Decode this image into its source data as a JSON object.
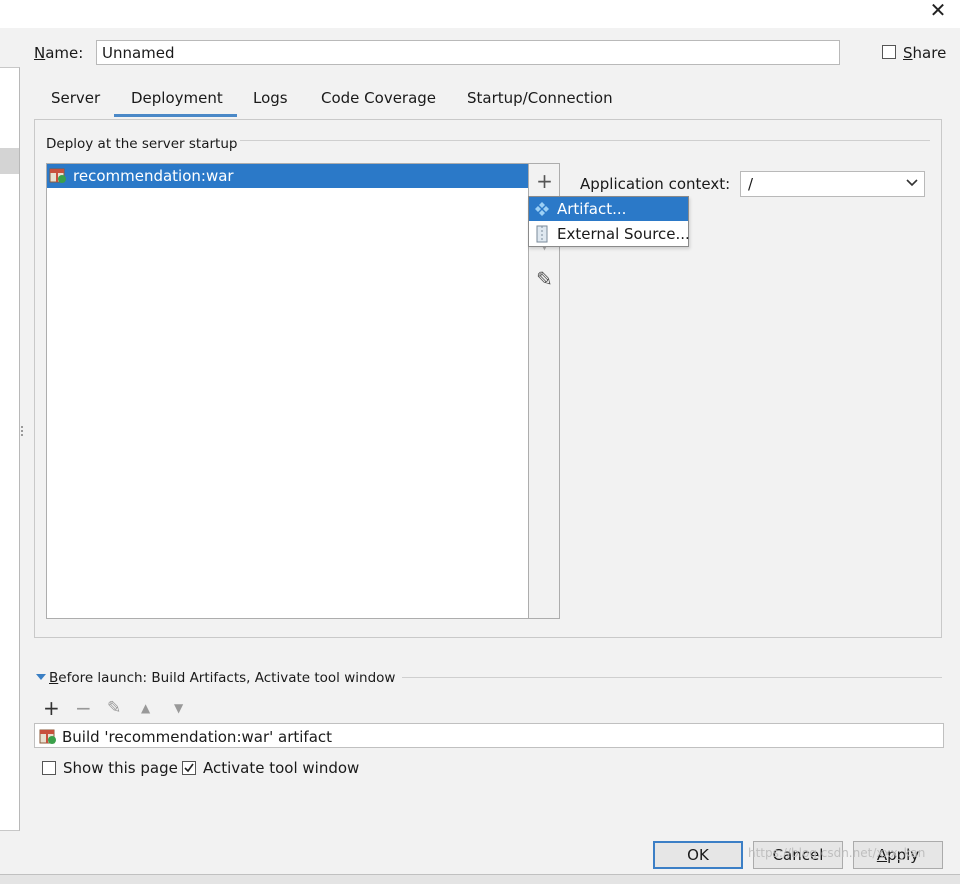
{
  "window": {
    "close_glyph": "✕"
  },
  "name": {
    "label_prefix": "",
    "label_mnemonic": "N",
    "label_rest": "ame:",
    "value": "Unnamed"
  },
  "share": {
    "label_mnemonic": "S",
    "label_rest": "hare",
    "checked": false
  },
  "tabs": [
    {
      "label": "Server",
      "active": false
    },
    {
      "label": "Deployment",
      "active": true
    },
    {
      "label": "Logs",
      "active": false
    },
    {
      "label": "Code Coverage",
      "active": false
    },
    {
      "label": "Startup/Connection",
      "active": false
    }
  ],
  "deploy": {
    "section_title": "Deploy at the server startup",
    "items": [
      {
        "label": "recommendation:war",
        "icon": "war-artifact-icon",
        "selected": true
      }
    ],
    "toolbar": [
      {
        "name": "add-icon",
        "glyph": "+"
      },
      {
        "name": "remove-icon",
        "glyph": "−"
      },
      {
        "name": "move-down-icon",
        "glyph": "▼"
      },
      {
        "name": "edit-icon",
        "glyph": "✎"
      }
    ]
  },
  "app_context": {
    "label": "Application context:",
    "value": "/"
  },
  "popup": {
    "items": [
      {
        "label": "Artifact...",
        "icon": "artifact-icon",
        "highlighted": true
      },
      {
        "label": "External Source...",
        "icon": "external-source-icon",
        "highlighted": false
      }
    ]
  },
  "before_launch": {
    "title_mnemonic": "B",
    "title_rest": "efore launch: Build Artifacts, Activate tool window",
    "toolbar": [
      {
        "name": "add-icon",
        "glyph": "+"
      },
      {
        "name": "remove-icon",
        "glyph": "−"
      },
      {
        "name": "edit-icon",
        "glyph": "✎"
      },
      {
        "name": "move-up-icon",
        "glyph": "▲"
      },
      {
        "name": "move-down-icon",
        "glyph": "▼"
      }
    ],
    "items": [
      {
        "label": "Build 'recommendation:war' artifact",
        "icon": "build-artifact-icon"
      }
    ],
    "show_this_page": {
      "label": "Show this page",
      "checked": false
    },
    "activate_tool_window": {
      "label": "Activate tool window",
      "checked": true
    }
  },
  "buttons": {
    "ok": "OK",
    "cancel": "Cancel",
    "apply_mnemonic": "A",
    "apply_rest": "pply"
  },
  "watermark": "https://blog.csdn.net/xxx_kan",
  "colors": {
    "selection": "#2b79c8",
    "tab_underline": "#4a88c7",
    "ok_border": "#3c7fc6"
  }
}
